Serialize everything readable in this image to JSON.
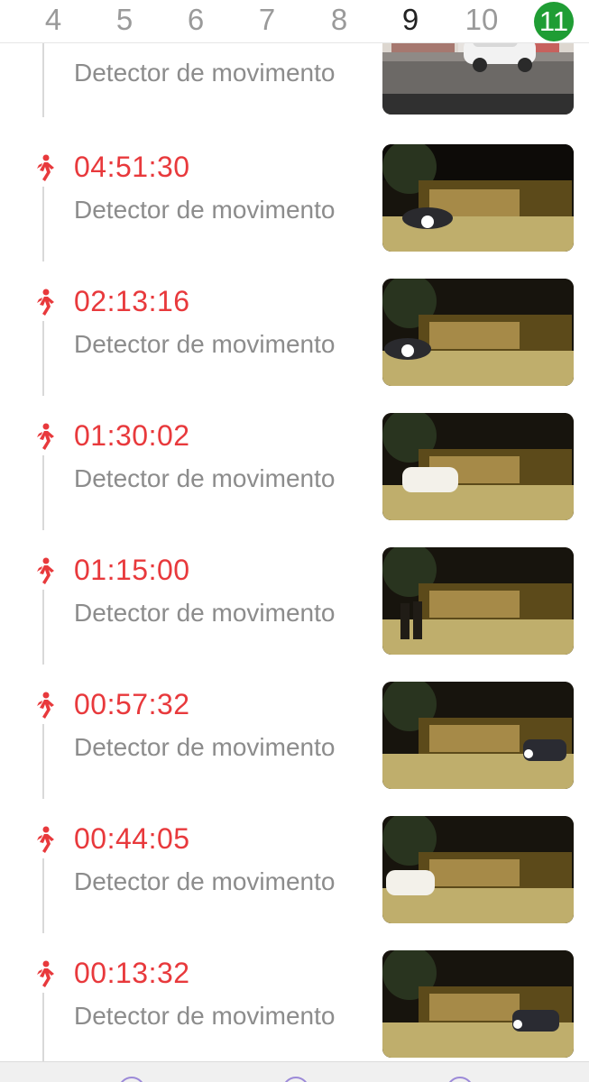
{
  "date_strip": {
    "days": [
      "4",
      "5",
      "6",
      "7",
      "8",
      "9",
      "10",
      "11"
    ],
    "selected": "11",
    "colors": {
      "selected_bg": "#1f9d34",
      "inactive": "#9a9a9a",
      "near": "#222222"
    }
  },
  "events": [
    {
      "time": "",
      "label": "Detector de movimento",
      "scene": "day-car",
      "icon": "running-person-icon"
    },
    {
      "time": "04:51:30",
      "label": "Detector de movimento",
      "scene": "night-car-left",
      "icon": "running-person-icon"
    },
    {
      "time": "02:13:16",
      "label": "Detector de movimento",
      "scene": "night-car-left",
      "icon": "running-person-icon"
    },
    {
      "time": "01:30:02",
      "label": "Detector de movimento",
      "scene": "night-car-white",
      "icon": "running-person-icon"
    },
    {
      "time": "01:15:00",
      "label": "Detector de movimento",
      "scene": "night-people",
      "icon": "running-person-icon"
    },
    {
      "time": "00:57:32",
      "label": "Detector de movimento",
      "scene": "night-car-right",
      "icon": "running-person-icon"
    },
    {
      "time": "00:44:05",
      "label": "Detector de movimento",
      "scene": "night-car-white",
      "icon": "running-person-icon"
    },
    {
      "time": "00:13:32",
      "label": "Detector de movimento",
      "scene": "night-car-right",
      "icon": "running-person-icon"
    }
  ],
  "colors": {
    "time": "#e8393c",
    "label": "#8c8c8c",
    "rail": "#d9d9d9",
    "bottom_icon": "#9c8ad8"
  },
  "bottom_bar": {
    "buttons": [
      "nav-button-1",
      "nav-button-2",
      "nav-button-3"
    ]
  }
}
